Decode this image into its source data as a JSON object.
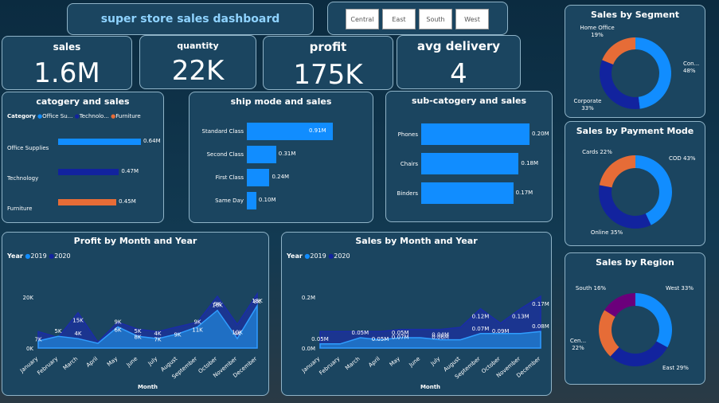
{
  "title": "super store sales dashboard",
  "slicer": [
    "Central",
    "East",
    "South",
    "West"
  ],
  "kpis": {
    "sales": {
      "label": "sales",
      "value": "1.6M"
    },
    "quantity": {
      "label": "quantity",
      "value": "22K"
    },
    "profit": {
      "label": "profit",
      "value": "175K"
    },
    "avg_delivery": {
      "label": "avg delivery",
      "value": "4"
    }
  },
  "colors": {
    "blue": "#118dff",
    "navy": "#12239e",
    "orange": "#e66c37",
    "purple": "#6b007b",
    "light": "#41a4ff"
  },
  "chart_data": [
    {
      "type": "bar",
      "title": "catogery and sales",
      "legend_title": "Category",
      "legend": [
        "Office Su...",
        "Technolo...",
        "Furniture"
      ],
      "categories": [
        "Office Supplies",
        "Technology",
        "Furniture"
      ],
      "values": [
        0.64,
        0.47,
        0.45
      ],
      "labels": [
        "0.64M",
        "0.47M",
        "0.45M"
      ]
    },
    {
      "type": "bar",
      "title": "ship mode and sales",
      "categories": [
        "Standard Class",
        "Second Class",
        "First Class",
        "Same Day"
      ],
      "values": [
        0.91,
        0.31,
        0.24,
        0.1
      ],
      "labels": [
        "0.91M",
        "0.31M",
        "0.24M",
        "0.10M"
      ]
    },
    {
      "type": "bar",
      "title": "sub-catogery and sales",
      "categories": [
        "Phones",
        "Chairs",
        "Binders"
      ],
      "values": [
        0.2,
        0.18,
        0.17
      ],
      "labels": [
        "0.20M",
        "0.18M",
        "0.17M"
      ]
    },
    {
      "type": "pie",
      "title": "Sales by Segment",
      "slices": [
        {
          "label": "Con...",
          "pct": 48,
          "text": "48%"
        },
        {
          "label": "Corporate",
          "pct": 33,
          "text": "33%"
        },
        {
          "label": "Home Office",
          "pct": 19,
          "text": "19%"
        }
      ]
    },
    {
      "type": "pie",
      "title": "Sales by Payment Mode",
      "slices": [
        {
          "label": "COD 43%",
          "pct": 43
        },
        {
          "label": "Online 35%",
          "pct": 35
        },
        {
          "label": "Cards 22%",
          "pct": 22
        }
      ]
    },
    {
      "type": "pie",
      "title": "Sales by Region",
      "slices": [
        {
          "label": "West 33%",
          "pct": 33
        },
        {
          "label": "East 29%",
          "pct": 29
        },
        {
          "label": "Cen...\n22%",
          "pct": 22
        },
        {
          "label": "South 16%",
          "pct": 16
        }
      ]
    },
    {
      "type": "area",
      "title": "Profit by Month and Year",
      "legend_title": "Year",
      "legend": [
        "2019",
        "2020"
      ],
      "xlabel": "Month",
      "yticks": [
        "20K",
        "0K"
      ],
      "x": [
        "January",
        "February",
        "March",
        "April",
        "May",
        "June",
        "July",
        "August",
        "September",
        "October",
        "November",
        "December"
      ],
      "series": [
        {
          "name": "2019",
          "values": [
            3.0,
            5.0,
            4.0,
            2.0,
            9.0,
            5.0,
            4.0,
            6.0,
            9.0,
            16.0,
            4.0,
            18.0
          ],
          "labels": [
            "",
            "5K",
            "4K",
            "",
            "9K",
            "5K",
            "4K",
            "",
            "9K",
            "16K",
            "4K",
            "18K"
          ]
        },
        {
          "name": "2020",
          "values": [
            7.0,
            4.5,
            15.0,
            2.5,
            11.0,
            8.0,
            7.0,
            9.0,
            11.0,
            22.0,
            10.0,
            23.0
          ],
          "labels": [
            "7K",
            "",
            "15K",
            "",
            "6K",
            "8K",
            "7K",
            "9K",
            "11K",
            "9K",
            "10K",
            "8K"
          ]
        }
      ]
    },
    {
      "type": "area",
      "title": "Sales by Month and Year",
      "legend_title": "Year",
      "legend": [
        "2019",
        "2020"
      ],
      "xlabel": "Month",
      "yticks": [
        "0.2M",
        "0.0M"
      ],
      "x": [
        "January",
        "February",
        "March",
        "April",
        "May",
        "June",
        "July",
        "August",
        "September",
        "October",
        "November",
        "December"
      ],
      "series": [
        {
          "name": "2019",
          "values": [
            0.02,
            0.02,
            0.05,
            0.04,
            0.05,
            0.05,
            0.04,
            0.04,
            0.07,
            0.07,
            0.07,
            0.08
          ],
          "labels": [
            "0.05M",
            "",
            "0.05M",
            "",
            "0.05M",
            "",
            "0.04M",
            "",
            "0.07M",
            "",
            "",
            "0.08M"
          ]
        },
        {
          "name": "2020",
          "values": [
            0.08,
            0.08,
            0.08,
            0.08,
            0.09,
            0.09,
            0.09,
            0.1,
            0.19,
            0.12,
            0.19,
            0.25
          ],
          "labels": [
            "",
            "",
            "",
            "0.05M",
            "0.07M",
            "",
            "0.06M",
            "",
            "0.12M",
            "0.09M",
            "0.13M",
            "0.17M"
          ]
        }
      ]
    }
  ]
}
